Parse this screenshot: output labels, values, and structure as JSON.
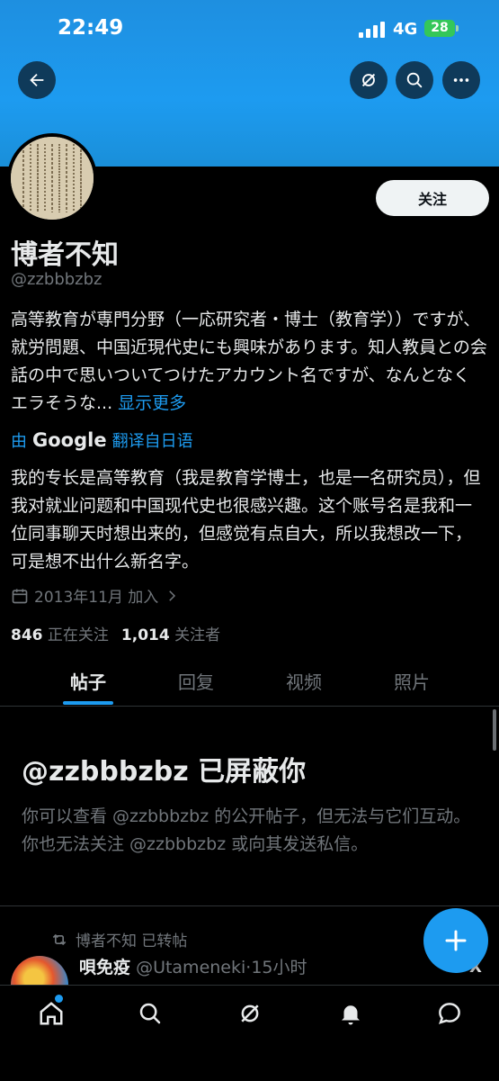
{
  "status_bar": {
    "time": "22:49",
    "network": "4G",
    "battery": "28"
  },
  "profile": {
    "follow_label": "关注",
    "display_name": "博者不知",
    "handle": "@zzbbbzbz",
    "bio": "高等教育が専門分野（一応研究者・博士（教育学））ですが、就労問題、中国近現代史にも興味があります。知人教員との会話の中で思いついてつけたアカウント名ですが、なんとなくエラそうな...",
    "show_more": "显示更多",
    "translate_by": "由",
    "translate_provider": "Google",
    "translate_label": "翻译自日语",
    "translated_bio": "我的专长是高等教育（我是教育学博士，也是一名研究员），但我对就业问题和中国现代史也很感兴趣。这个账号名是我和一位同事聊天时想出来的，但感觉有点自大，所以我想改一下，可是想不出什么新名字。",
    "joined": "2013年11月 加入",
    "following_count": "846",
    "following_label": "正在关注",
    "followers_count": "1,014",
    "followers_label": "关注者"
  },
  "tabs": [
    {
      "label": "帖子"
    },
    {
      "label": "回复"
    },
    {
      "label": "视频"
    },
    {
      "label": "照片"
    }
  ],
  "blocked": {
    "title": "@zzbbbzbz 已屏蔽你",
    "description": "你可以查看 @zzbbbzbz 的公开帖子，但无法与它们互动。你也无法关注 @zzbbbzbz 或向其发送私信。"
  },
  "tweet": {
    "retweet_label": "博者不知 已转帖",
    "author_name": "唄免疫",
    "author_handle": "@Utameneki",
    "time_ago": "·15小时"
  },
  "colors": {
    "accent": "#1d9bf0",
    "banner": "#1d9bf0",
    "background": "#000000"
  }
}
